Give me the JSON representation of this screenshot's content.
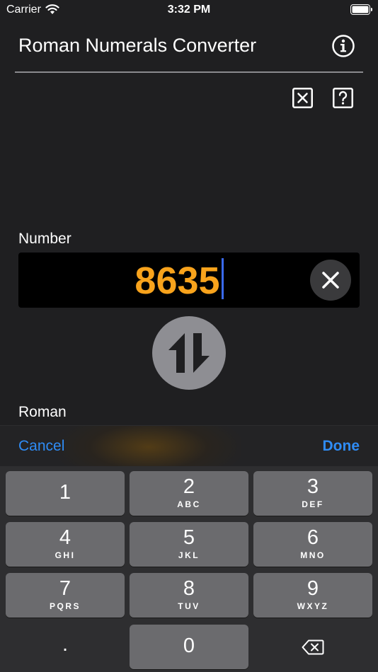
{
  "status_bar": {
    "carrier": "Carrier",
    "time": "3:32 PM"
  },
  "nav": {
    "title": "Roman Numerals Converter",
    "info_icon": "info-circle-icon"
  },
  "toolbar_top": {
    "clear_icon": "x-square-icon",
    "help_icon": "question-square-icon"
  },
  "number_section": {
    "label": "Number",
    "value": "8635",
    "clear_icon": "x-circle-icon"
  },
  "swap_icon": "swap-arrows-icon",
  "roman_section": {
    "label": "Roman"
  },
  "input_toolbar": {
    "cancel": "Cancel",
    "done": "Done"
  },
  "keypad": {
    "keys": [
      {
        "digit": "1",
        "letters": ""
      },
      {
        "digit": "2",
        "letters": "ABC"
      },
      {
        "digit": "3",
        "letters": "DEF"
      },
      {
        "digit": "4",
        "letters": "GHI"
      },
      {
        "digit": "5",
        "letters": "JKL"
      },
      {
        "digit": "6",
        "letters": "MNO"
      },
      {
        "digit": "7",
        "letters": "PQRS"
      },
      {
        "digit": "8",
        "letters": "TUV"
      },
      {
        "digit": "9",
        "letters": "WXYZ"
      },
      {
        "digit": "0",
        "letters": ""
      }
    ],
    "dot": ".",
    "delete_icon": "backspace-icon"
  },
  "colors": {
    "accent": "#2f8cf5",
    "number": "#f8a31c",
    "caret": "#3a6af0",
    "background": "#1f1f21"
  }
}
